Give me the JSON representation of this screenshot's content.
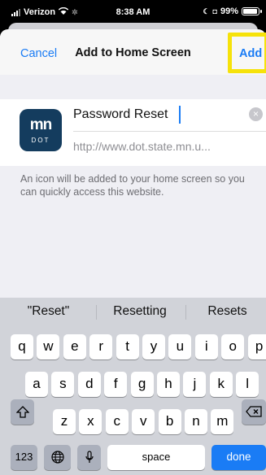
{
  "status_bar": {
    "carrier": "Verizon",
    "time": "8:38 AM",
    "battery": "99%"
  },
  "nav": {
    "cancel": "Cancel",
    "title": "Add to Home Screen",
    "add": "Add"
  },
  "bookmark": {
    "icon_text": "mn",
    "icon_subtext": "DOT",
    "name": "Password Reset",
    "url": "http://www.dot.state.mn.u..."
  },
  "note": "An icon will be added to your home screen so you can quickly access this website.",
  "keyboard": {
    "predictions": [
      "\"Reset\"",
      "Resetting",
      "Resets"
    ],
    "rows": {
      "row1": [
        "q",
        "w",
        "e",
        "r",
        "t",
        "y",
        "u",
        "i",
        "o",
        "p"
      ],
      "row2": [
        "a",
        "s",
        "d",
        "f",
        "g",
        "h",
        "j",
        "k",
        "l"
      ],
      "row3": [
        "z",
        "x",
        "c",
        "v",
        "b",
        "n",
        "m"
      ]
    },
    "numbers": "123",
    "space": "space",
    "done": "done"
  }
}
